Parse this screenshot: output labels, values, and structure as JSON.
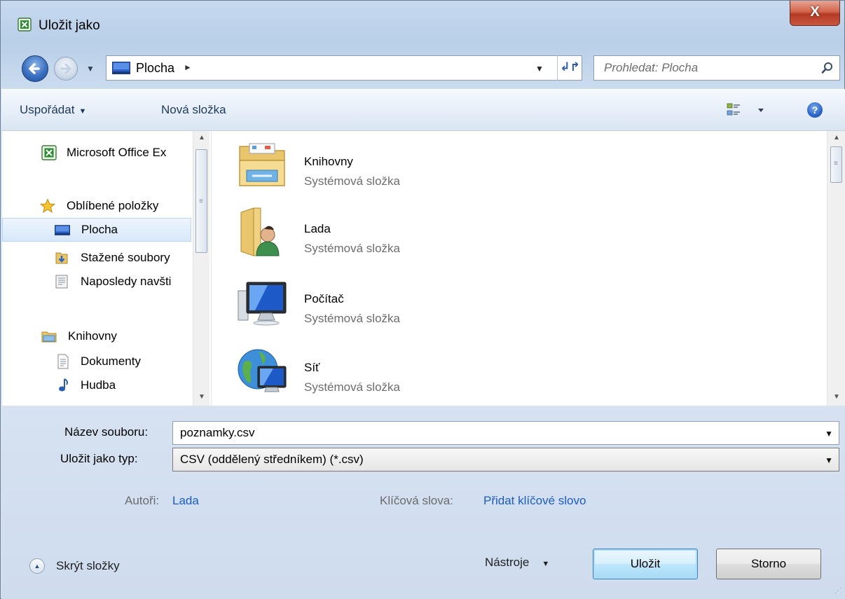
{
  "window": {
    "title": "Uložit jako",
    "close_label": "X"
  },
  "address": {
    "location": "Plocha",
    "search_placeholder": "Prohledat: Plocha"
  },
  "toolbar": {
    "organize": "Uspořádat",
    "new_folder": "Nová složka"
  },
  "nav_pane": {
    "items": [
      {
        "label": "Microsoft Office Ex",
        "icon": "excel-icon"
      },
      {
        "label": "Oblíbené položky",
        "icon": "star-icon"
      },
      {
        "label": "Plocha",
        "icon": "desktop-icon",
        "selected": true
      },
      {
        "label": "Stažené soubory",
        "icon": "downloads-icon"
      },
      {
        "label": "Naposledy navšti",
        "icon": "recent-places-icon"
      },
      {
        "label": "Knihovny",
        "icon": "libraries-icon"
      },
      {
        "label": "Dokumenty",
        "icon": "documents-icon"
      },
      {
        "label": "Hudba",
        "icon": "music-icon"
      }
    ]
  },
  "content": {
    "items": [
      {
        "name": "Knihovny",
        "type": "Systémová složka",
        "icon": "libraries-folder-icon"
      },
      {
        "name": "Lada",
        "type": "Systémová složka",
        "icon": "user-folder-icon"
      },
      {
        "name": "Počítač",
        "type": "Systémová složka",
        "icon": "computer-icon"
      },
      {
        "name": "Síť",
        "type": "Systémová složka",
        "icon": "network-icon"
      }
    ]
  },
  "form": {
    "filename_label": "Název souboru:",
    "filename_value": "poznamky.csv",
    "filetype_label": "Uložit jako typ:",
    "filetype_value": "CSV (oddělený středníkem) (*.csv)",
    "authors_label": "Autoři:",
    "authors_value": "Lada",
    "keywords_label": "Klíčová slova:",
    "keywords_value": "Přidat klíčové slovo"
  },
  "footer": {
    "hide_folders": "Skrýt složky",
    "tools": "Nástroje",
    "save": "Uložit",
    "cancel": "Storno"
  }
}
